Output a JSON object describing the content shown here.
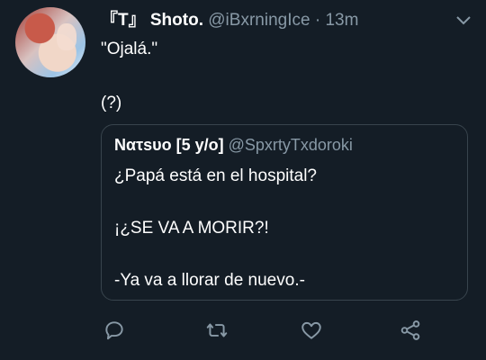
{
  "tweet": {
    "display_name": "『T』 Shoto.",
    "handle": "@iBxrningIce",
    "separator": "·",
    "time": "13m",
    "lines": [
      "\"Ojalá.\"",
      "(?)"
    ]
  },
  "quoted": {
    "display_name": "Nατsυο [5 y/o]",
    "handle": "@SpxrtyTxdoroki",
    "lines": [
      "¿Papá está en el hospital?",
      "¡¿SE VA A MORIR?!",
      "-Ya va a llorar de nuevo.-"
    ]
  },
  "icons": {
    "caret": "chevron-down-icon",
    "reply": "reply-icon",
    "retweet": "retweet-icon",
    "like": "heart-icon",
    "share": "share-icon"
  },
  "colors": {
    "background": "#141d26",
    "muted": "#8899a6",
    "border": "#38444d"
  }
}
